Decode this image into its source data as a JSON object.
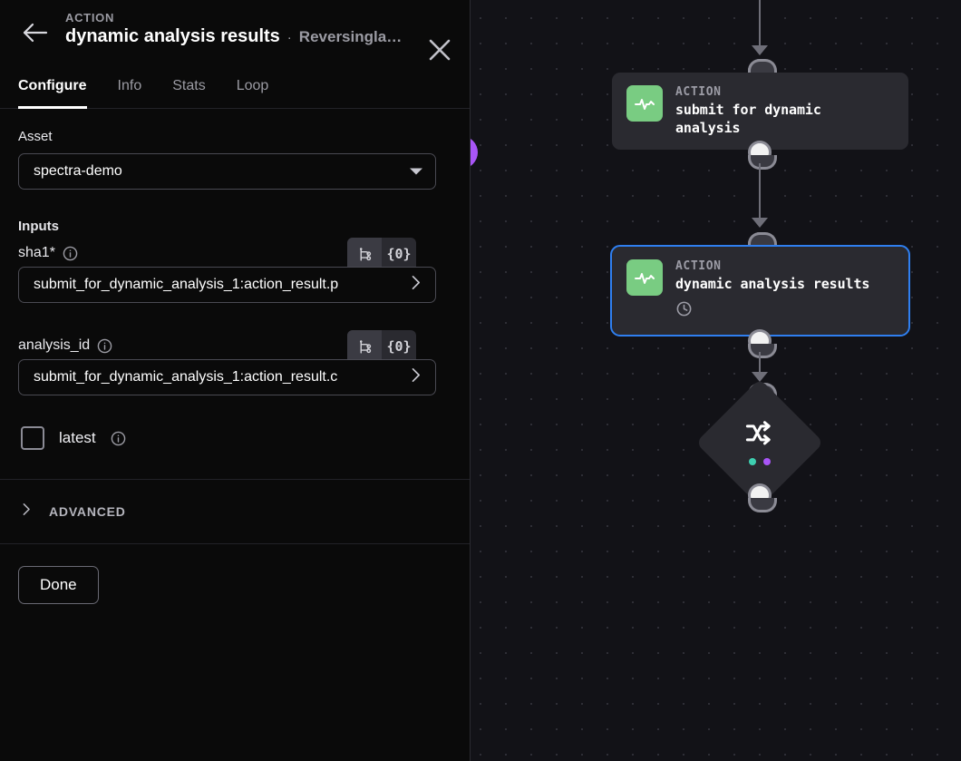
{
  "panel": {
    "back_icon": "arrow-left-icon",
    "close_icon": "close-icon",
    "kicker": "ACTION",
    "title": "dynamic analysis results",
    "separator": "·",
    "subtitle": "Reversinglab…",
    "tabs": [
      {
        "label": "Configure",
        "active": true
      },
      {
        "label": "Info",
        "active": false
      },
      {
        "label": "Stats",
        "active": false
      },
      {
        "label": "Loop",
        "active": false
      }
    ],
    "asset": {
      "label": "Asset",
      "value": "spectra-demo",
      "options": [
        "spectra-demo"
      ]
    },
    "inputs_heading": "Inputs",
    "inputs": [
      {
        "label": "sha1*",
        "info_icon": "info-icon",
        "mode_branch_icon": "branch-icon",
        "mode_braces": "{0}",
        "value": "submit_for_dynamic_analysis_1:action_result.p",
        "expand_icon": "chevron-right-icon"
      },
      {
        "label": "analysis_id",
        "info_icon": "info-icon",
        "mode_branch_icon": "branch-icon",
        "mode_braces": "{0}",
        "value": "submit_for_dynamic_analysis_1:action_result.c",
        "expand_icon": "chevron-right-icon"
      }
    ],
    "checkbox": {
      "label": "latest",
      "checked": false,
      "info_icon": "info-icon"
    },
    "advanced": {
      "label": "ADVANCED",
      "chevron_icon": "chevron-right-icon",
      "expanded": false
    },
    "done_label": "Done"
  },
  "canvas": {
    "background": "#121217",
    "grid_dot_color": "#2e2e36",
    "accent_selected": "#2f7ff0",
    "action_icon_color": "#79cc82",
    "nodes": [
      {
        "kind": "ACTION",
        "title": "submit for dynamic analysis",
        "icon": "activity-pulse-icon",
        "selected": false,
        "meta_icon": null
      },
      {
        "kind": "ACTION",
        "title": "dynamic analysis results",
        "icon": "activity-pulse-icon",
        "selected": true,
        "meta_icon": "clock-icon"
      }
    ],
    "decision": {
      "icon": "branch-shuffle-icon",
      "dots": [
        "#3ecfb0",
        "#a855f7"
      ]
    },
    "offscreen_node_color": "#a855f7"
  }
}
